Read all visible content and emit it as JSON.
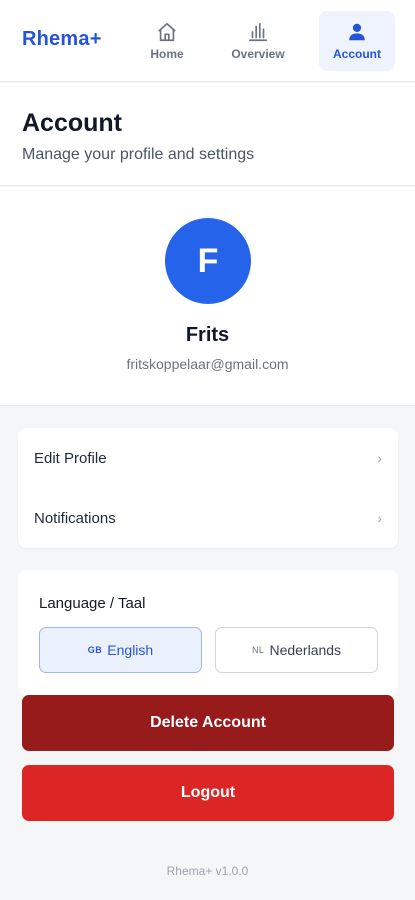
{
  "brand": "Rhema+",
  "nav": {
    "home": {
      "label": "Home",
      "icon": "home-icon"
    },
    "overview": {
      "label": "Overview",
      "icon": "bar-chart-icon"
    },
    "account": {
      "label": "Account",
      "icon": "user-icon",
      "active": true
    }
  },
  "header": {
    "title": "Account",
    "subtitle": "Manage your profile and settings"
  },
  "profile": {
    "initial": "F",
    "name": "Frits",
    "email": "fritskoppelaar@gmail.com"
  },
  "menu": {
    "items": [
      {
        "label": "Edit Profile",
        "chevron": "›"
      },
      {
        "label": "Notifications",
        "chevron": "›"
      }
    ]
  },
  "language": {
    "title": "Language / Taal",
    "options": [
      {
        "flag": "GB",
        "label": "English",
        "selected": true
      },
      {
        "flag": "NL",
        "label": "Nederlands",
        "selected": false
      }
    ]
  },
  "actions": {
    "delete_label": "Delete Account",
    "logout_label": "Logout"
  },
  "footer": {
    "version": "Rhema+ v1.0.0"
  },
  "colors": {
    "brand": "#2554d9",
    "avatar": "#2563eb",
    "delete": "#981b1b",
    "logout": "#dc2626"
  }
}
